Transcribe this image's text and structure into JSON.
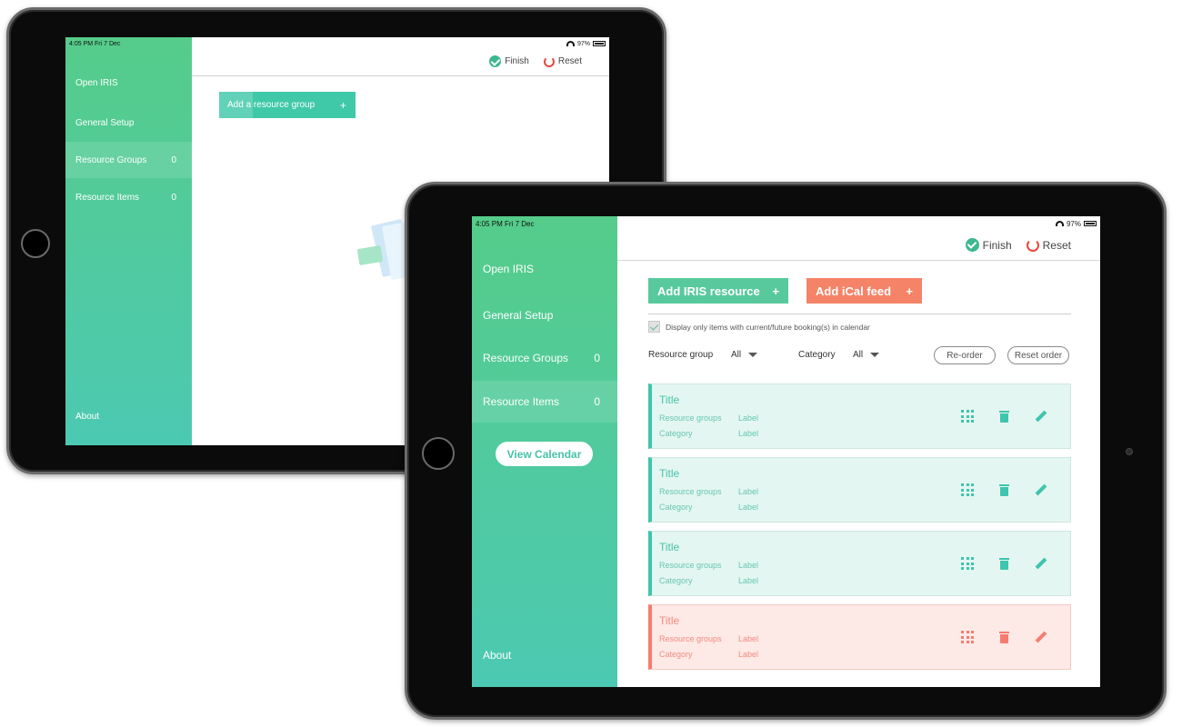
{
  "back": {
    "status": {
      "time": "4:05 PM  Fri 7 Dec",
      "battery": "97%"
    },
    "nav": {
      "open_iris": "Open IRIS",
      "general_setup": "General Setup",
      "resource_groups": {
        "label": "Resource Groups",
        "count": "0"
      },
      "resource_items": {
        "label": "Resource Items",
        "count": "0"
      },
      "about": "About"
    },
    "topbar": {
      "finish": "Finish",
      "reset": "Reset"
    },
    "add_group_label": "Add a resource group",
    "add_plus": "+"
  },
  "front": {
    "status": {
      "time": "4:05 PM   Fri 7 Dec",
      "battery": "97%"
    },
    "nav": {
      "open_iris": "Open IRIS",
      "general_setup": "General Setup",
      "resource_groups": {
        "label": "Resource Groups",
        "count": "0"
      },
      "resource_items": {
        "label": "Resource Items",
        "count": "0"
      },
      "view_calendar": "View Calendar",
      "about": "About"
    },
    "topbar": {
      "finish": "Finish",
      "reset": "Reset"
    },
    "actions": {
      "add_iris": "Add IRIS resource",
      "add_ical": "Add iCal feed",
      "plus": "+"
    },
    "display_only_label": "Display only items with current/future booking(s) in calendar",
    "filters": {
      "resource_group_label": "Resource group",
      "resource_group_value": "All",
      "category_label": "Category",
      "category_value": "All",
      "reorder": "Re-order",
      "reset_order": "Reset order"
    },
    "items": [
      {
        "title": "Title",
        "row1_label": "Resource groups",
        "row1_value": "Label",
        "row2_label": "Category",
        "row2_value": "Label",
        "state": "normal"
      },
      {
        "title": "Title",
        "row1_label": "Resource groups",
        "row1_value": "Label",
        "row2_label": "Category",
        "row2_value": "Label",
        "state": "normal"
      },
      {
        "title": "Title",
        "row1_label": "Resource groups",
        "row1_value": "Label",
        "row2_label": "Category",
        "row2_value": "Label",
        "state": "normal"
      },
      {
        "title": "Title",
        "row1_label": "Resource groups",
        "row1_value": "Label",
        "row2_label": "Category",
        "row2_value": "Label",
        "state": "error"
      }
    ]
  },
  "colors": {
    "sidebar_top": "#55cc8a",
    "sidebar_bottom": "#4cc9b2",
    "teal": "#3ec5ad",
    "salmon": "#f58367",
    "reset_red": "#e8473e"
  }
}
